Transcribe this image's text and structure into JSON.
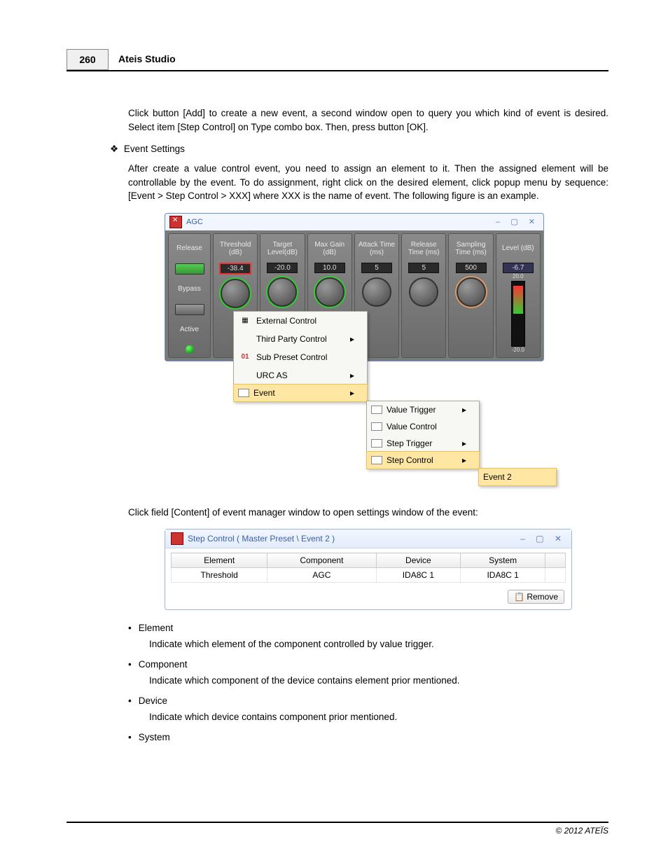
{
  "header": {
    "page": "260",
    "title": "Ateis Studio"
  },
  "para1": "Click button [Add] to create a new event, a second window open to query you which kind of event is desired. Select item [Step Control] on Type combo box. Then, press button [OK].",
  "section": {
    "symbol": "❖",
    "title": "Event Settings"
  },
  "para2": "After create a value control event, you need to assign an element to it. Then the assigned element will be controllable by the event. To do assignment, right click on the desired element, click popup menu by sequence: [Event > Step Control > XXX] where XXX is the name of event. The following figure is an example.",
  "agc": {
    "title": "AGC",
    "side": [
      "Release",
      "Bypass",
      "Active"
    ],
    "cols": [
      {
        "h": "Threshold (dB)",
        "v": "-38.4",
        "red": true,
        "knob": "g"
      },
      {
        "h": "Target Level(dB)",
        "v": "-20.0",
        "knob": "g"
      },
      {
        "h": "Max Gain (dB)",
        "v": "10.0",
        "knob": "g"
      },
      {
        "h": "Attack Time (ms)",
        "v": "5",
        "knob": ""
      },
      {
        "h": "Release Time (ms)",
        "v": "5",
        "knob": ""
      },
      {
        "h": "Sampling Time (ms)",
        "v": "500",
        "knob": "o"
      }
    ],
    "level": {
      "h": "Level (dB)",
      "v": "-6.7",
      "top": "20.0",
      "bot": "-20.0"
    }
  },
  "menu1": [
    {
      "t": "External Control",
      "ic": "▦"
    },
    {
      "t": "Third Party Control",
      "arrow": true
    },
    {
      "t": "Sub Preset Control",
      "ic": "01"
    },
    {
      "t": "URC AS",
      "arrow": true
    },
    {
      "t": "Event",
      "arrow": true,
      "hl": true,
      "ic": "▭"
    }
  ],
  "menu2": [
    {
      "t": "Value Trigger",
      "arrow": true
    },
    {
      "t": "Value Control"
    },
    {
      "t": "Step Trigger",
      "arrow": true
    },
    {
      "t": "Step Control",
      "arrow": true,
      "hl": true
    }
  ],
  "menu3": [
    {
      "t": "Event 2",
      "hl": true
    }
  ],
  "para3": "Click field [Content] of event manager window to open settings window of the event:",
  "win2": {
    "title": "Step Control ( Master Preset \\ Event 2 )",
    "headers": [
      "Element",
      "Component",
      "Device",
      "System"
    ],
    "row": [
      "Threshold",
      "AGC",
      "IDA8C 1",
      "IDA8C 1"
    ],
    "remove": "Remove"
  },
  "bullets": [
    {
      "h": "Element",
      "t": "Indicate which element of the component controlled by value trigger."
    },
    {
      "h": "Component",
      "t": "Indicate which component of the device contains element prior mentioned."
    },
    {
      "h": "Device",
      "t": "Indicate which device contains component prior mentioned."
    },
    {
      "h": "System",
      "t": ""
    }
  ],
  "footer": "© 2012 ATEÏS"
}
